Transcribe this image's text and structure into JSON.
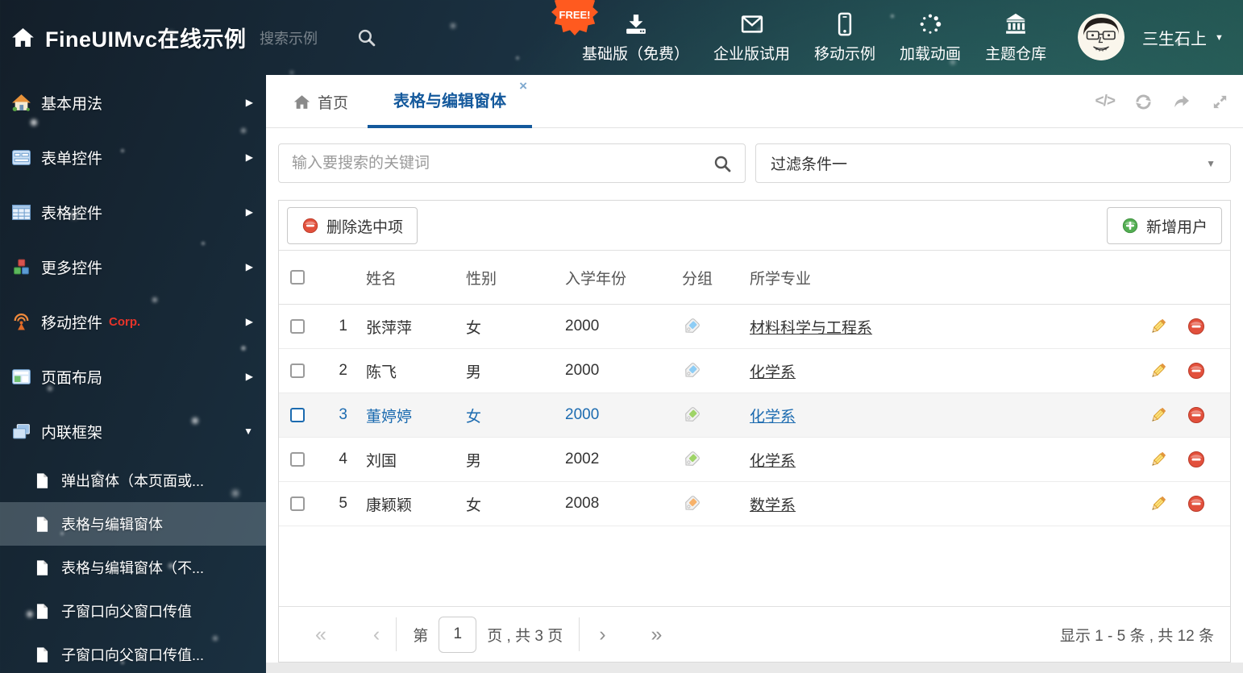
{
  "header": {
    "title": "FineUIMvc在线示例",
    "search_placeholder": "搜索示例",
    "free_badge": "FREE!",
    "nav_items": [
      {
        "icon": "i-download",
        "label": "基础版（免费）"
      },
      {
        "icon": "i-envelope",
        "label": "企业版试用"
      },
      {
        "icon": "i-mobile",
        "label": "移动示例"
      },
      {
        "icon": "i-spinner",
        "label": "加载动画"
      },
      {
        "icon": "i-bank",
        "label": "主题仓库"
      }
    ],
    "username": "三生石上",
    "caret": "▼"
  },
  "sidebar": {
    "items": [
      {
        "icon": "i-home-color",
        "label": "基本用法",
        "arrow": "▶"
      },
      {
        "icon": "i-form",
        "label": "表单控件",
        "arrow": "▶"
      },
      {
        "icon": "i-table",
        "label": "表格控件",
        "arrow": "▶"
      },
      {
        "icon": "i-cubes",
        "label": "更多控件",
        "arrow": "▶"
      },
      {
        "icon": "i-antenna",
        "label": "移动控件",
        "badge": "Corp.",
        "arrow": "▶"
      },
      {
        "icon": "i-layout",
        "label": "页面布局",
        "arrow": "▶"
      },
      {
        "icon": "i-frames",
        "label": "内联框架",
        "arrow": "▼",
        "expanded": true
      }
    ],
    "subitems": [
      {
        "label": "弹出窗体（本页面或..."
      },
      {
        "label": "表格与编辑窗体",
        "selected": true
      },
      {
        "label": "表格与编辑窗体（不..."
      },
      {
        "label": "子窗口向父窗口传值"
      },
      {
        "label": "子窗口向父窗口传值..."
      }
    ]
  },
  "tabbar": {
    "home_tab": "首页",
    "active_tab": "表格与编辑窗体",
    "close_glyph": "×",
    "code_glyph": "</>"
  },
  "filter_bar": {
    "search_placeholder": "输入要搜索的关键词",
    "filter_value": "过滤条件一",
    "caret": "▼"
  },
  "toolbar": {
    "delete_label": "删除选中项",
    "add_label": "新增用户"
  },
  "table": {
    "columns": {
      "name": "姓名",
      "gender": "性别",
      "year": "入学年份",
      "group": "分组",
      "major": "所学专业"
    },
    "rows": [
      {
        "num": "1",
        "name": "张萍萍",
        "gender": "女",
        "year": "2000",
        "tag_color": "#8ecdf5",
        "major": "材料科学与工程系"
      },
      {
        "num": "2",
        "name": "陈飞",
        "gender": "男",
        "year": "2000",
        "tag_color": "#8ecdf5",
        "major": "化学系"
      },
      {
        "num": "3",
        "name": "董婷婷",
        "gender": "女",
        "year": "2000",
        "tag_color": "#9fd468",
        "major": "化学系",
        "selected": true
      },
      {
        "num": "4",
        "name": "刘国",
        "gender": "男",
        "year": "2002",
        "tag_color": "#9fd468",
        "major": "化学系"
      },
      {
        "num": "5",
        "name": "康颖颖",
        "gender": "女",
        "year": "2008",
        "tag_color": "#f8b26a",
        "major": "数学系"
      }
    ]
  },
  "pagination": {
    "first": "«",
    "prev": "‹",
    "next": "›",
    "last": "»",
    "page_prefix": "第",
    "page_value": "1",
    "page_suffix": "页 , 共 3 页",
    "summary": "显示 1 - 5 条 , 共 12 条"
  },
  "colors": {
    "accent_blue": "#14599c",
    "selected_blue": "#1c6bb0",
    "free_orange": "#ff5a1f",
    "corp_red": "#e8342a",
    "tag_blue": "#8ecdf5",
    "tag_green": "#9fd468",
    "tag_orange": "#f8b26a"
  }
}
